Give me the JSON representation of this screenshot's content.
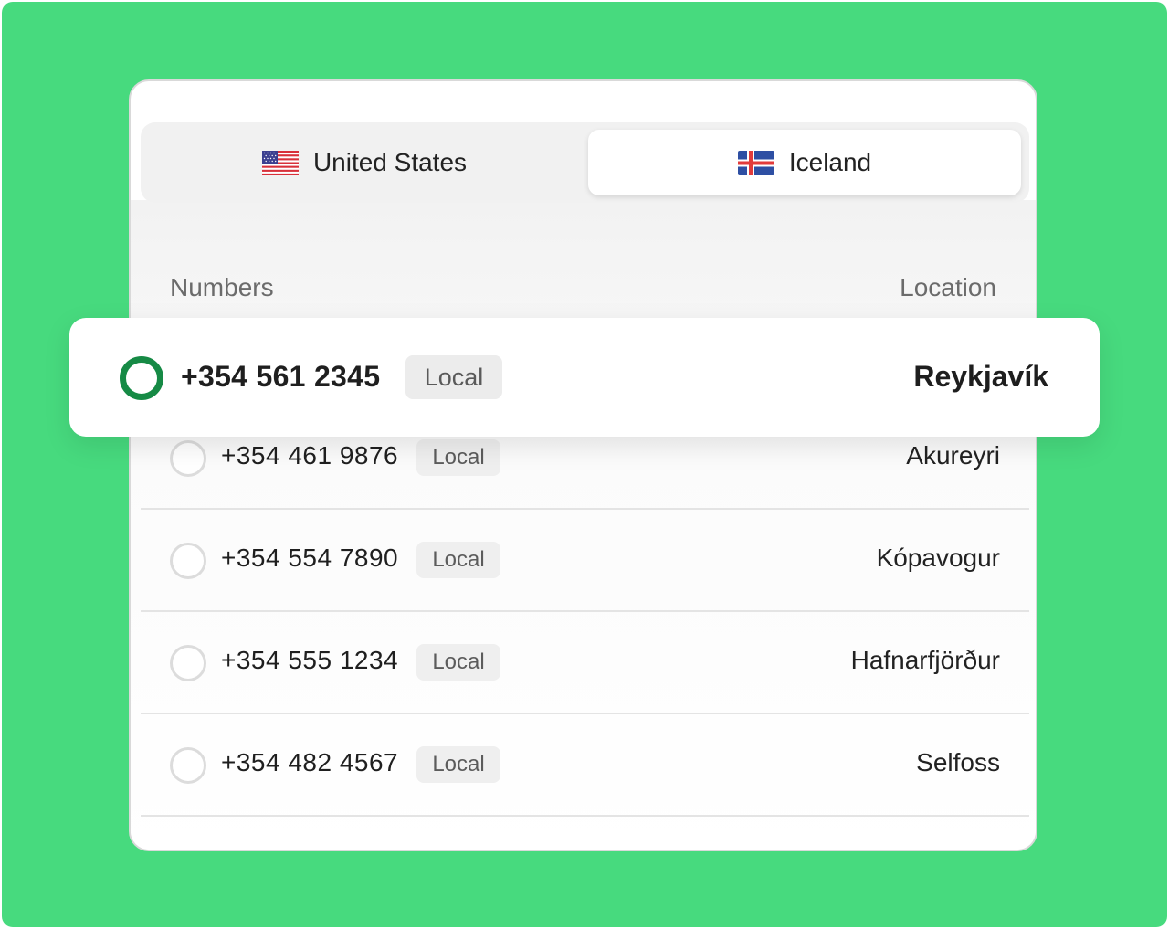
{
  "tabs": [
    {
      "label": "United States",
      "flag": "us-flag-icon",
      "selected": false
    },
    {
      "label": "Iceland",
      "flag": "iceland-flag-icon",
      "selected": true
    }
  ],
  "columns": {
    "numbers": "Numbers",
    "location": "Location"
  },
  "selected_row": {
    "number": "+354 561 2345",
    "type": "Local",
    "location": "Reykjavík"
  },
  "rows": [
    {
      "number": "+354 461 9876",
      "type": "Local",
      "location": "Akureyri"
    },
    {
      "number": "+354 554 7890",
      "type": "Local",
      "location": "Kópavogur"
    },
    {
      "number": "+354 555 1234",
      "type": "Local",
      "location": "Hafnarfjörður"
    },
    {
      "number": "+354 482 4567",
      "type": "Local",
      "location": "Selfoss"
    }
  ],
  "colors": {
    "background": "#47da7e",
    "selected_radio": "#168a45"
  }
}
